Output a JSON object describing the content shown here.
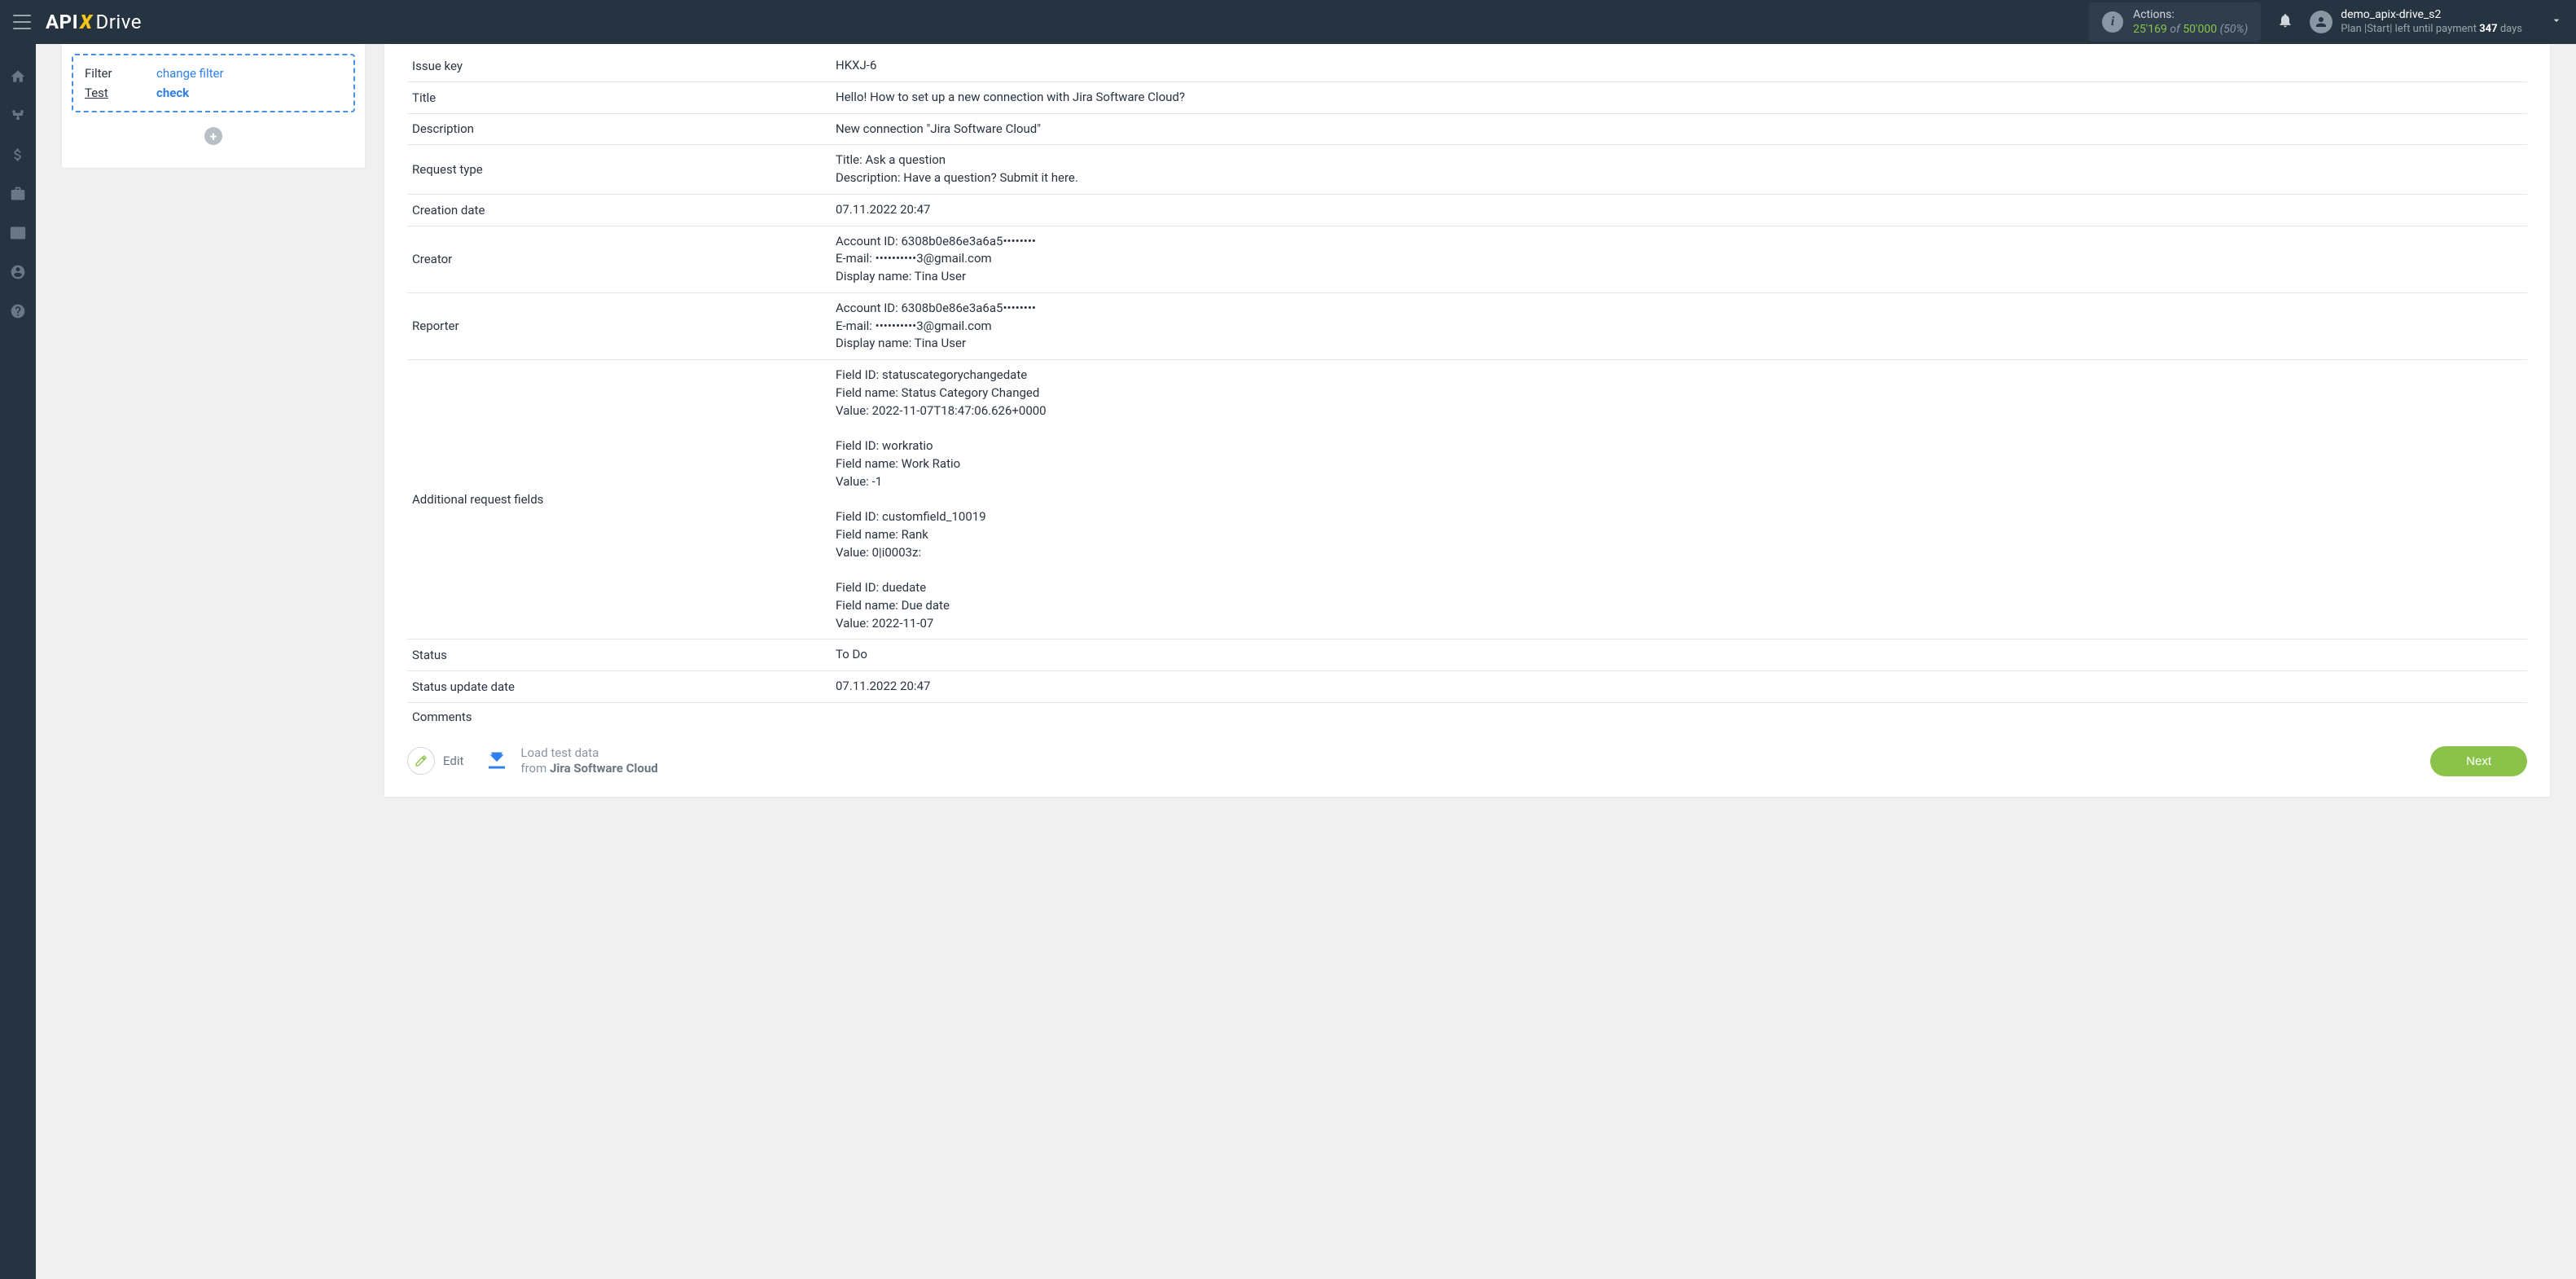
{
  "header": {
    "logo": {
      "api": "API",
      "x": "X",
      "drive": "Drive"
    },
    "actions": {
      "label": "Actions:",
      "used": "25'169",
      "of": "of",
      "total": "50'000",
      "pct": "(50%)"
    },
    "user": {
      "name": "demo_apix-drive_s2",
      "plan_prefix": "Plan |Start| left until payment ",
      "days_num": "347",
      "days_suffix": " days"
    }
  },
  "sidebar": {
    "filter_label": "Filter",
    "filter_link": "change filter",
    "test_label": "Test",
    "test_link": "check",
    "add": "+"
  },
  "table": {
    "rows": [
      {
        "key": "Issue key",
        "val": "HKXJ-6"
      },
      {
        "key": "Title",
        "val": "Hello! How to set up a new connection with Jira Software Cloud?"
      },
      {
        "key": "Description",
        "val": "New connection \"Jira Software Cloud\""
      },
      {
        "key": "Request type",
        "val": "Title: Ask a question\nDescription: Have a question? Submit it here."
      },
      {
        "key": "Creation date",
        "val": "07.11.2022 20:47"
      },
      {
        "key": "Creator",
        "val": "Account ID: 6308b0e86e3a6a5••••••••\nE-mail: ••••••••••3@gmail.com\nDisplay name: Tina User"
      },
      {
        "key": "Reporter",
        "val": "Account ID: 6308b0e86e3a6a5••••••••\nE-mail: ••••••••••3@gmail.com\nDisplay name: Tina User"
      },
      {
        "key": "Additional request fields",
        "val": "Field ID: statuscategorychangedate\nField name: Status Category Changed\nValue: 2022-11-07T18:47:06.626+0000\n\nField ID: workratio\nField name: Work Ratio\nValue: -1\n\nField ID: customfield_10019\nField name: Rank\nValue: 0|i0003z:\n\nField ID: duedate\nField name: Due date\nValue: 2022-11-07"
      },
      {
        "key": "Status",
        "val": "To Do"
      },
      {
        "key": "Status update date",
        "val": "07.11.2022 20:47"
      },
      {
        "key": "Comments",
        "val": ""
      }
    ]
  },
  "footer": {
    "edit": "Edit",
    "load_line1": "Load test data",
    "load_from": "from ",
    "load_src": "Jira Software Cloud",
    "next": "Next"
  }
}
